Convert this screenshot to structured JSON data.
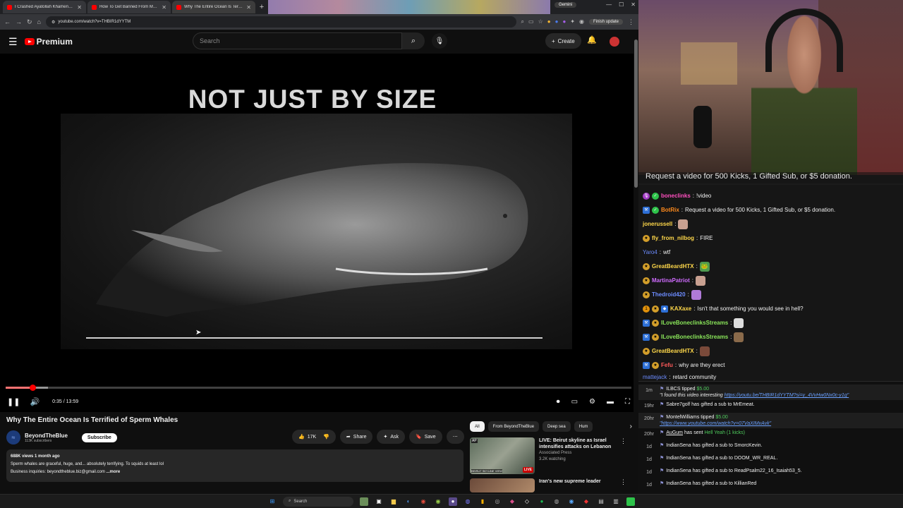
{
  "browser": {
    "tabs": [
      {
        "title": "I Crashed Ayatollah Khamenei's..."
      },
      {
        "title": "How To Get Banned From MGM..."
      },
      {
        "title": "Why The Entire Ocean Is Terrified..."
      }
    ],
    "gemini_label": "Gemini",
    "url": "youtube.com/watch?v=THBIR1dYYTM",
    "finish_update": "Finish update"
  },
  "youtube": {
    "logo_label": "Premium",
    "search_placeholder": "Search",
    "create_label": "Create",
    "video_overlay_text": "NOT JUST BY SIZE",
    "progress": 0.0423,
    "buffered": 0.068,
    "time": "0:35 / 13:59",
    "video_title": "Why The Entire Ocean Is Terrified of Sperm Whales",
    "channel_name": "BeyondTheBlue",
    "channel_subs": "113K subscribers",
    "subscribe_label": "Subscribe",
    "likes": "17K",
    "share_label": "Share",
    "ask_label": "Ask",
    "save_label": "Save",
    "views_age": "688K views  1 month ago",
    "description_line": "Sperm whales are graceful, huge, and... absolutely terrifying. To squids at least lol",
    "business_line": "Business inquiries: beyondtheblue.biz@gmail.com",
    "more_label": "...more",
    "chips": [
      "All",
      "From BeyondTheBlue",
      "Deep sea",
      "Hum"
    ],
    "recs": [
      {
        "title": "LIVE: Beirut skyline as Israel intensifies attacks on Lebanon",
        "channel": "Associated Press",
        "meta": "3.2K watching",
        "live_badge": "LIVE",
        "thumb_caption": "BEIRUT SKYLINE VIEW",
        "thumb_tag": "AP"
      },
      {
        "title": "Iran's new supreme leader",
        "channel": "",
        "meta": ""
      }
    ]
  },
  "stream": {
    "chat_top_text": "Request a video for 500 Kicks, 1 Gifted Sub, or $5 donation.",
    "messages": [
      {
        "user": "boneclinks",
        "color": "#ff4fbf",
        "text": "!video"
      },
      {
        "user": "BotRix",
        "color": "#ff8a1c",
        "text": "Request a video for 500 Kicks, 1 Gifted Sub, or $5 donation."
      },
      {
        "user": "jonerussell",
        "color": "#ffd84a",
        "text": ""
      },
      {
        "user": "fly_from_nilbog",
        "color": "#ffd84a",
        "text": "FIRE"
      },
      {
        "user": "Yaro4",
        "color": "#6c8cff",
        "text": "wtf"
      },
      {
        "user": "GreatBeardHTX",
        "color": "#ffd84a",
        "text": ""
      },
      {
        "user": "MartinaPatriot",
        "color": "#d06cff",
        "text": ""
      },
      {
        "user": "Thedroid420",
        "color": "#6c8cff",
        "text": ""
      },
      {
        "user": "KAXaxe",
        "color": "#ffd84a",
        "text": "Isn't that something you would see in hell?"
      },
      {
        "user": "ILoveBoneclinksStreams",
        "color": "#8ae65a",
        "text": ""
      },
      {
        "user": "ILoveBoneclinksStreams",
        "color": "#8ae65a",
        "text": ""
      },
      {
        "user": "GreatBeardHTX",
        "color": "#ffd84a",
        "text": ""
      },
      {
        "user": "Fefu",
        "color": "#ff5a5a",
        "text": "why are they erect"
      },
      {
        "user": "mattejack",
        "color": "#6c8cff",
        "text": "retard community"
      }
    ],
    "events": [
      {
        "time": "1m",
        "user": "ILBCS",
        "action": " tipped ",
        "amount": "$5.00",
        "note": "\"I found this video interesting ",
        "link": "https://youtu.be/THBIR1dYYTM?si=y_4VvHw0Nx0c-y1g\""
      },
      {
        "time": "19hr",
        "user": "Sabre7golf",
        "action": " has gifted a sub to ",
        "target": "MrEmeat."
      },
      {
        "time": "20hr",
        "user": "MontelWilliams",
        "action": " tipped ",
        "amount": "$5.00",
        "link": "\"https://www.youtube.com/watch?v=07VaXIMvAvk\""
      },
      {
        "time": "20hr",
        "user": "AuGum",
        "action": " has sent ",
        "amount": "Hell Yeah (1 kicks)"
      },
      {
        "time": "1d",
        "user": "IndianSena",
        "action": " has gifted a sub to ",
        "target": "SmorcKevin."
      },
      {
        "time": "1d",
        "user": "IndianSena",
        "action": " has gifted a sub to ",
        "target": "DOOM_WR_REAL."
      },
      {
        "time": "1d",
        "user": "IndianSena",
        "action": " has gifted a sub to ",
        "target": "ReadPsalm22_16_Isaiah53_5."
      },
      {
        "time": "1d",
        "user": "IndianSena",
        "action": " has gifted a sub to ",
        "target": "KillianRed"
      }
    ]
  },
  "taskbar": {
    "search_label": "Search"
  }
}
